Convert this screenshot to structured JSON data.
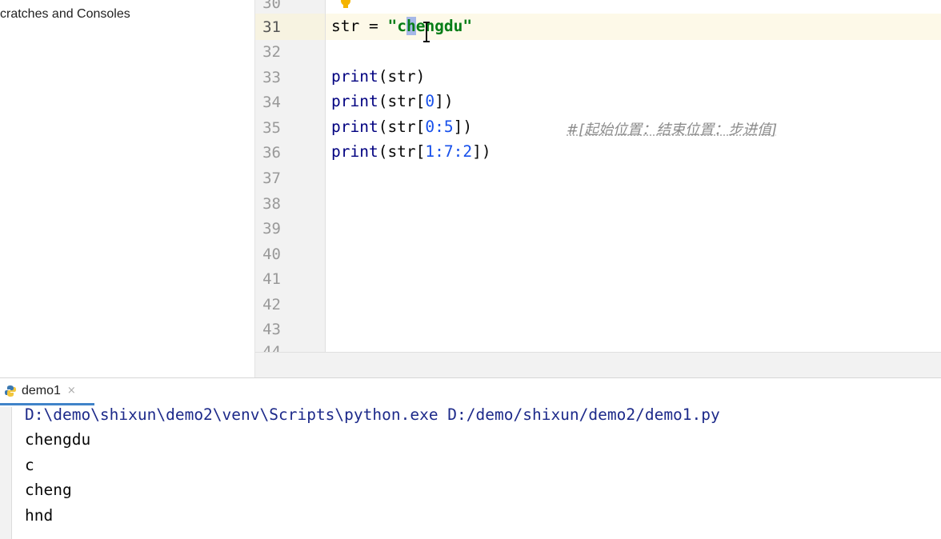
{
  "sidebar": {
    "tree_item": "cratches and Consoles"
  },
  "editor": {
    "line_numbers": [
      "30",
      "31",
      "32",
      "33",
      "34",
      "35",
      "36",
      "37",
      "38",
      "39",
      "40",
      "41",
      "42",
      "43",
      "44"
    ],
    "current_line": "31",
    "lines": {
      "l31_var": "str",
      "l31_op": " = ",
      "l31_q1": "\"c",
      "l31_sel": "h",
      "l31_rest": "engdu\"",
      "l33_fn": "print",
      "l33_args": "(str)",
      "l34_fn": "print",
      "l34_a": "(str[",
      "l34_n": "0",
      "l34_b": "])",
      "l35_fn": "print",
      "l35_a": "(str[",
      "l35_n": "0:5",
      "l35_b": "])",
      "l36_fn": "print",
      "l36_a": "(str[",
      "l36_n": "1:7:2",
      "l36_b": "])"
    },
    "comment": "#[起始位置：结束位置：步进值]"
  },
  "run": {
    "tab_label": "demo1",
    "tab_close": "×",
    "console": [
      "D:\\demo\\shixun\\demo2\\venv\\Scripts\\python.exe D:/demo/shixun/demo2/demo1.py",
      "chengdu",
      "c",
      "cheng",
      "hnd"
    ]
  },
  "colors": {
    "keyword": "#000080",
    "string": "#067d17",
    "number": "#1750eb",
    "comment": "#8c8c8c",
    "caret_row": "#fdf9e8"
  }
}
